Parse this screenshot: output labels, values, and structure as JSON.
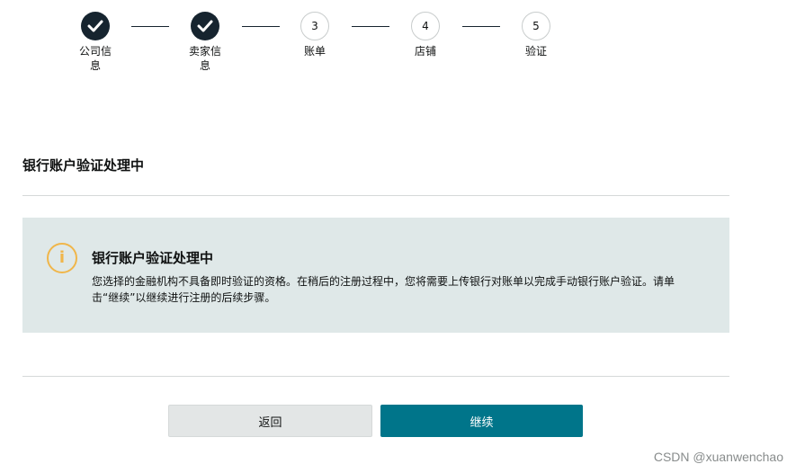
{
  "steps": [
    {
      "label": "公司信息",
      "state": "done"
    },
    {
      "label": "卖家信息",
      "state": "done"
    },
    {
      "number": "3",
      "label": "账单",
      "state": "todo"
    },
    {
      "number": "4",
      "label": "店铺",
      "state": "todo"
    },
    {
      "number": "5",
      "label": "验证",
      "state": "todo"
    }
  ],
  "section": {
    "title": "银行账户验证处理中"
  },
  "alert": {
    "icon": "info-icon",
    "title": "银行账户验证处理中",
    "body": "您选择的金融机构不具备即时验证的资格。在稍后的注册过程中，您将需要上传银行对账单以完成手动银行账户验证。请单击“继续”以继续进行注册的后续步骤。"
  },
  "buttons": {
    "back": "返回",
    "continue": "继续"
  },
  "watermark": "CSDN @xuanwenchao",
  "colors": {
    "accent": "#00758a",
    "step_done": "#16242f",
    "alert_bg": "#dfe8e8",
    "info": "#f0b64a"
  }
}
